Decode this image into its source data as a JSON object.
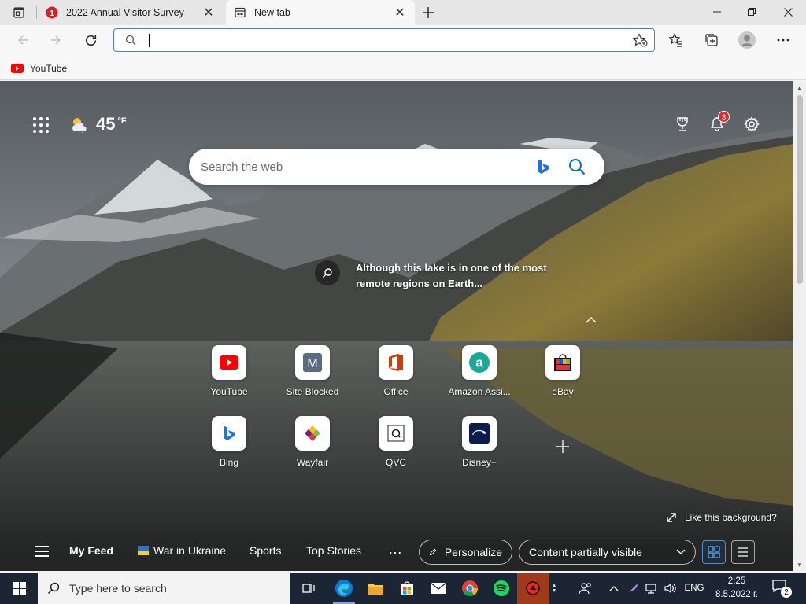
{
  "tabs": [
    {
      "title": "2022 Annual Visitor Survey",
      "badge": "1",
      "active": false
    },
    {
      "title": "New tab",
      "active": true
    }
  ],
  "address_bar": {
    "value": "",
    "placeholder": ""
  },
  "favorites": [
    {
      "label": "YouTube",
      "icon": "youtube-icon"
    }
  ],
  "ntp": {
    "weather": {
      "temperature": "45",
      "unit": "°F",
      "icon": "partly-cloudy-icon"
    },
    "notification_count": "3",
    "search": {
      "placeholder": "Search the web"
    },
    "caption": "Although this lake is in one of the most remote regions on Earth...",
    "quick_links": [
      {
        "label": "YouTube",
        "icon": "youtube-icon",
        "color": "#ff0000"
      },
      {
        "label": "Site Blocked",
        "icon": "m-letter-icon",
        "color": "#5a6b82"
      },
      {
        "label": "Office",
        "icon": "office-icon",
        "color": "#d83b01"
      },
      {
        "label": "Amazon Assi...",
        "icon": "amazon-assistant-icon",
        "color": "#1ba99a"
      },
      {
        "label": "eBay",
        "icon": "ebay-bag-icon",
        "color": "#e53238"
      },
      {
        "label": "Bing",
        "icon": "bing-icon",
        "color": "#0078d4"
      },
      {
        "label": "Wayfair",
        "icon": "wayfair-icon",
        "color": "#7f187f"
      },
      {
        "label": "QVC",
        "icon": "qvc-icon",
        "color": "#333333"
      },
      {
        "label": "Disney+",
        "icon": "disney-plus-icon",
        "color": "#0b1d4f"
      }
    ],
    "like_background": "Like this background?",
    "feed": {
      "items": [
        "My Feed",
        "War in Ukraine",
        "Sports",
        "Top Stories",
        "…"
      ],
      "personalize": "Personalize",
      "content_dropdown": "Content partially visible"
    }
  },
  "taskbar": {
    "search_placeholder": "Type here to search",
    "language": "ENG",
    "time": "2:25",
    "date": "8.5.2022 г.",
    "notification_count": "2"
  }
}
